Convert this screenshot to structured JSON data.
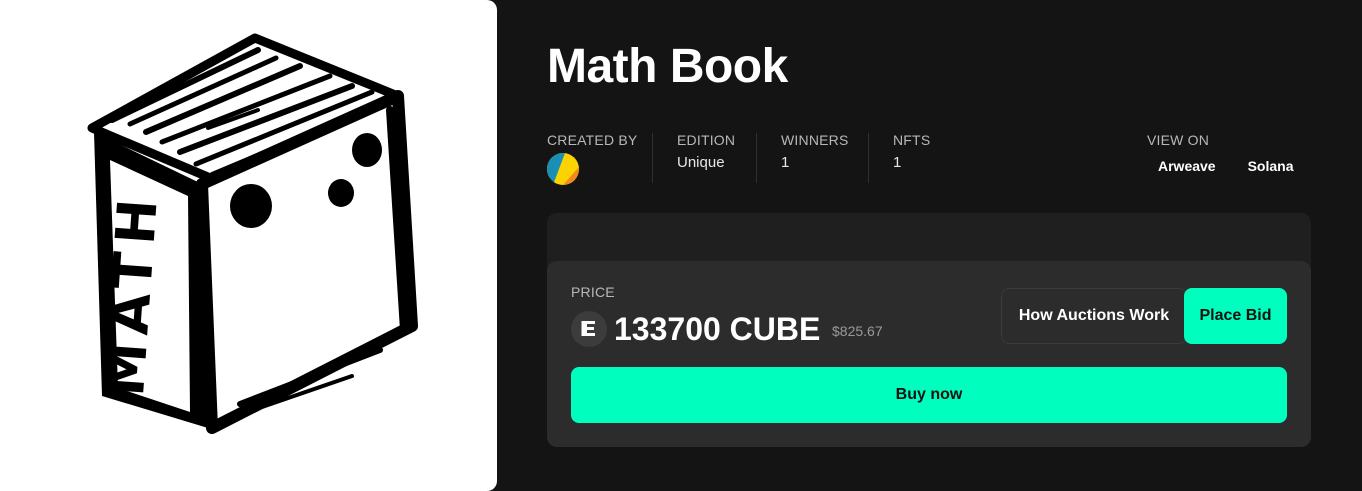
{
  "artwork": {
    "spine_text": "MATH",
    "alt": "Math Book"
  },
  "item": {
    "title": "Math Book"
  },
  "meta": {
    "created_by_label": "CREATED BY",
    "edition_label": "EDITION",
    "edition_value": "Unique",
    "winners_label": "WINNERS",
    "winners_value": "1",
    "nfts_label": "NFTS",
    "nfts_value": "1",
    "view_on_label": "VIEW ON",
    "view_on_links": [
      "Arweave",
      "Solana"
    ]
  },
  "auction": {
    "price_label": "PRICE",
    "price_amount": "133700 CUBE",
    "price_usd": "$825.67",
    "how_auctions_label": "How Auctions Work",
    "place_bid_label": "Place Bid",
    "buy_now_label": "Buy now"
  },
  "colors": {
    "background": "#141414",
    "accent": "#00ffbe",
    "card": "#2c2c2c",
    "card_outer": "#1f1f1f"
  },
  "icons": {
    "creator_avatar": "creator-avatar",
    "token": "cube-token-icon"
  }
}
